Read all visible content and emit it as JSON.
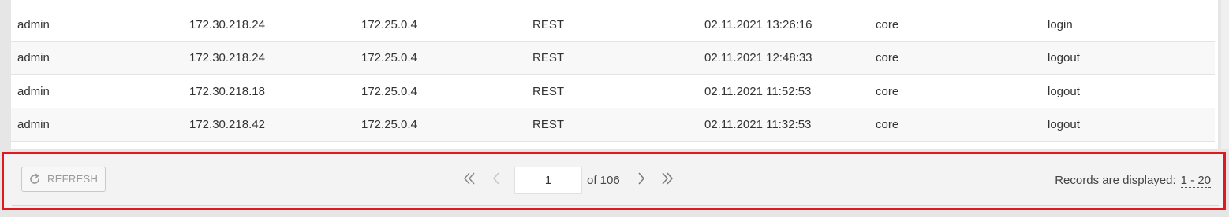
{
  "table": {
    "rows": [
      [
        "admin",
        "172.30.218.24",
        "172.25.0.4",
        "REST",
        "02.11.2021 13:26:16",
        "core",
        "login"
      ],
      [
        "admin",
        "172.30.218.24",
        "172.25.0.4",
        "REST",
        "02.11.2021 12:48:33",
        "core",
        "logout"
      ],
      [
        "admin",
        "172.30.218.18",
        "172.25.0.4",
        "REST",
        "02.11.2021 11:52:53",
        "core",
        "logout"
      ],
      [
        "admin",
        "172.30.218.42",
        "172.25.0.4",
        "REST",
        "02.11.2021 11:32:53",
        "core",
        "logout"
      ]
    ]
  },
  "footer": {
    "refresh_label": "REFRESH",
    "page_input": "1",
    "of_text": "of 106",
    "records_label": "Records are displayed:",
    "records_range": "1 - 20"
  },
  "icons": {
    "refresh": "refresh-icon",
    "first": "double-chevron-left-icon",
    "prev": "chevron-left-icon",
    "next": "chevron-right-icon",
    "last": "double-chevron-right-icon"
  },
  "colors": {
    "highlight_border": "#e0191e"
  }
}
